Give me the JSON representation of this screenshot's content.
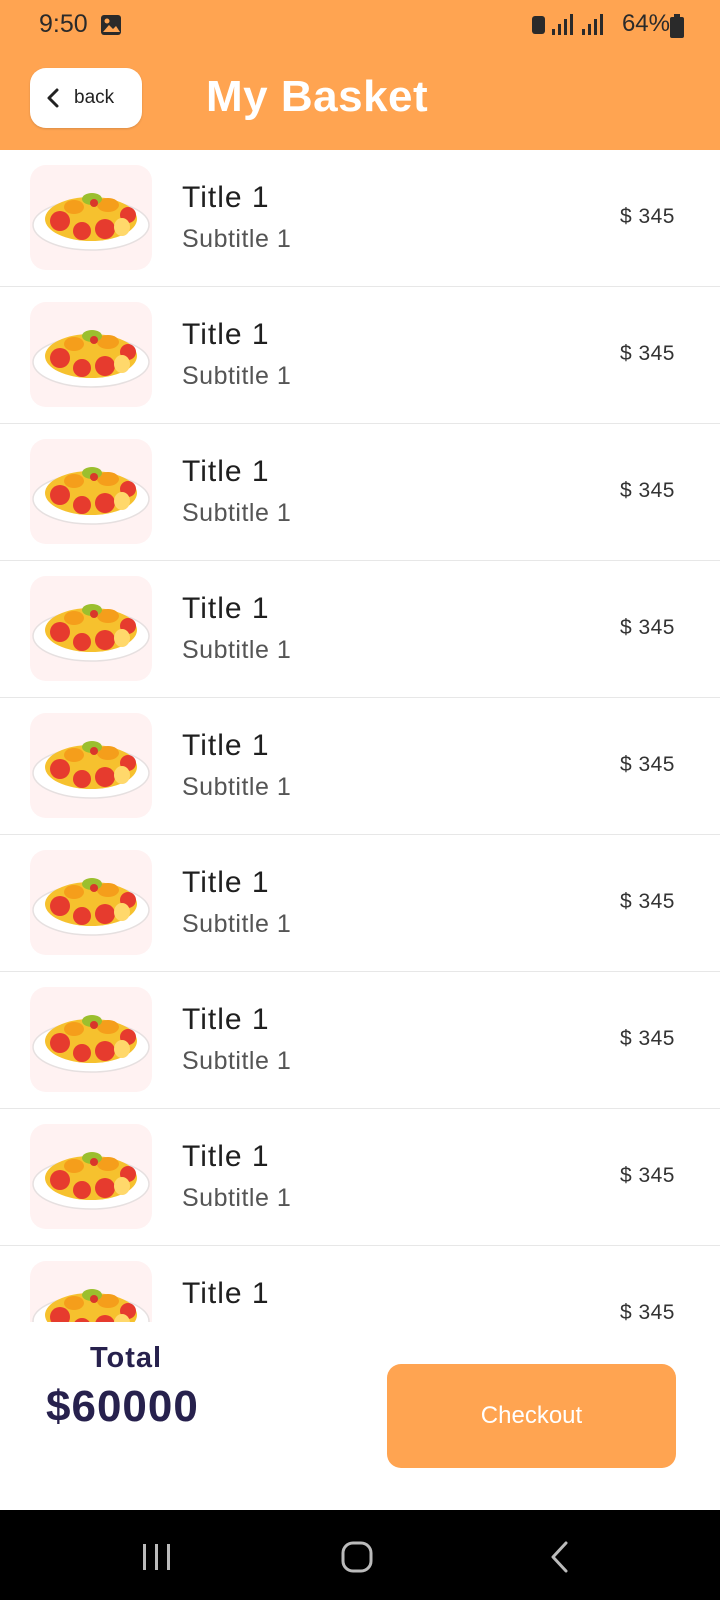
{
  "status_bar": {
    "time": "9:50",
    "battery": "64%"
  },
  "header": {
    "back_label": "back",
    "title": "My Basket"
  },
  "items": [
    {
      "title": "Title 1",
      "subtitle": "Subtitle 1",
      "price": "$ 345"
    },
    {
      "title": "Title 1",
      "subtitle": "Subtitle 1",
      "price": "$ 345"
    },
    {
      "title": "Title 1",
      "subtitle": "Subtitle 1",
      "price": "$ 345"
    },
    {
      "title": "Title 1",
      "subtitle": "Subtitle 1",
      "price": "$ 345"
    },
    {
      "title": "Title 1",
      "subtitle": "Subtitle 1",
      "price": "$ 345"
    },
    {
      "title": "Title 1",
      "subtitle": "Subtitle 1",
      "price": "$ 345"
    },
    {
      "title": "Title 1",
      "subtitle": "Subtitle 1",
      "price": "$ 345"
    },
    {
      "title": "Title 1",
      "subtitle": "Subtitle 1",
      "price": "$ 345"
    },
    {
      "title": "Title 1",
      "subtitle": "",
      "price": "$ 345"
    }
  ],
  "footer": {
    "total_label": "Total",
    "total_value": "$60000",
    "checkout_label": "Checkout"
  },
  "colors": {
    "accent": "#FFA451",
    "text_dark": "#27214D",
    "thumb_bg": "#FFF2F2"
  },
  "icons": [
    "gallery-icon",
    "battery-icon",
    "signal-icon",
    "chevron-left-icon",
    "fruit-salad-icon",
    "recents-icon",
    "home-icon",
    "back-nav-icon"
  ]
}
